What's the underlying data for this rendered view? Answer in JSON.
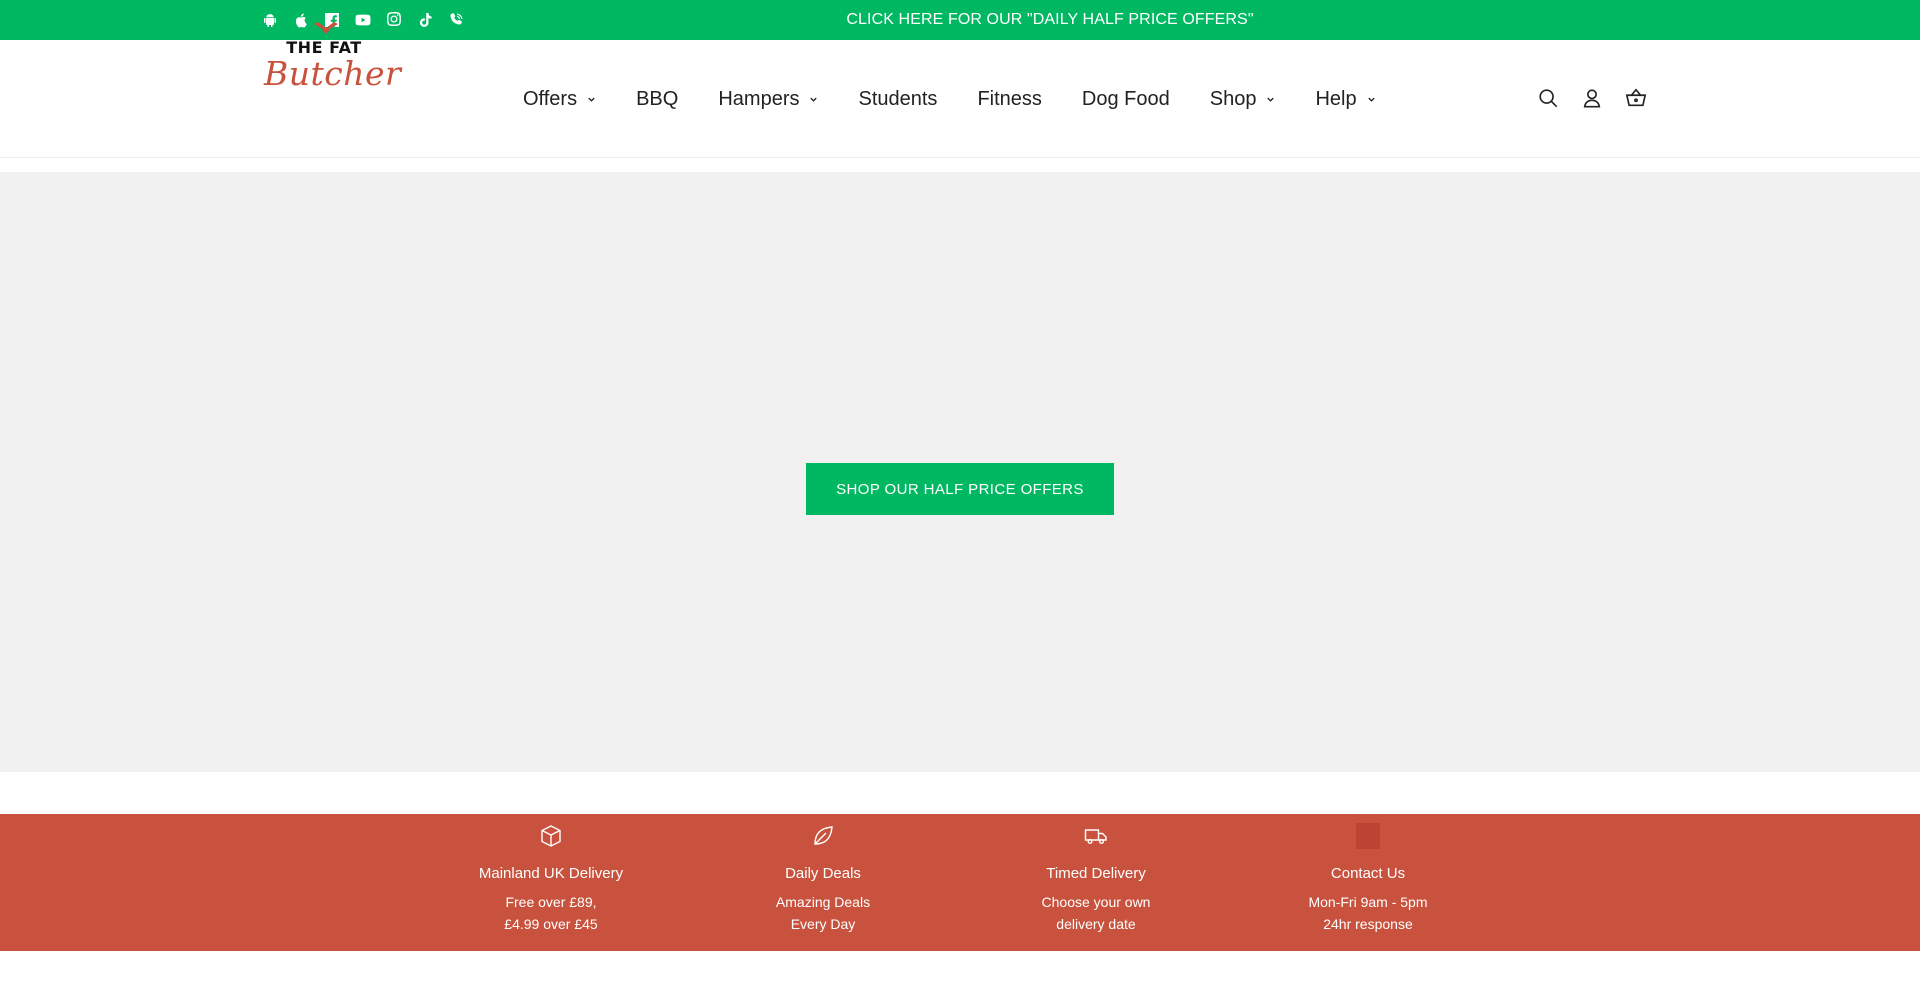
{
  "topbar": {
    "promo_text": "CLICK HERE FOR OUR \"DAILY HALF PRICE OFFERS\"",
    "social_icons": [
      "android-icon",
      "apple-icon",
      "facebook-icon",
      "youtube-icon",
      "instagram-icon",
      "tiktok-icon",
      "viber-icon"
    ],
    "background_color": "#00b862"
  },
  "header": {
    "logo": {
      "line1": "THE FAT",
      "line2": "Butcher"
    },
    "nav": [
      {
        "label": "Offers",
        "dropdown": true
      },
      {
        "label": "BBQ",
        "dropdown": false
      },
      {
        "label": "Hampers",
        "dropdown": true
      },
      {
        "label": "Students",
        "dropdown": false
      },
      {
        "label": "Fitness",
        "dropdown": false
      },
      {
        "label": "Dog Food",
        "dropdown": false
      },
      {
        "label": "Shop",
        "dropdown": true
      },
      {
        "label": "Help",
        "dropdown": true
      }
    ],
    "icons": [
      "search-icon",
      "account-icon",
      "basket-icon"
    ]
  },
  "hero": {
    "button_label": "SHOP OUR HALF PRICE OFFERS",
    "background_color": "#f1f1f1"
  },
  "features": {
    "background_color": "#c8523d",
    "items": [
      {
        "icon": "box-icon",
        "title": "Mainland UK Delivery",
        "line1": "Free over £89,",
        "line2": "£4.99 over £45"
      },
      {
        "icon": "leaf-icon",
        "title": "Daily Deals",
        "line1": "Amazing Deals",
        "line2": "Every Day"
      },
      {
        "icon": "truck-icon",
        "title": "Timed Delivery",
        "line1": "Choose your own",
        "line2": "delivery date"
      },
      {
        "icon": "contact-icon",
        "title": "Contact Us",
        "line1": "Mon-Fri 9am - 5pm",
        "line2": "24hr response"
      }
    ]
  }
}
